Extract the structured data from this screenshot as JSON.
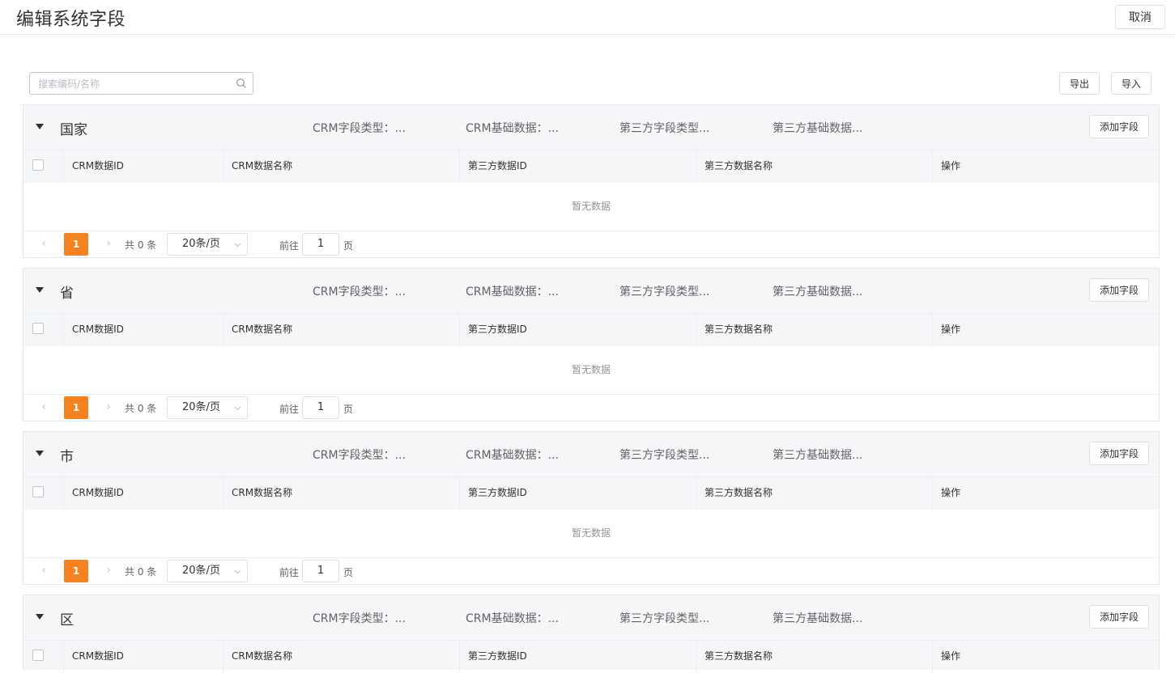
{
  "header": {
    "title": "编辑系统字段",
    "cancel_label": "取消"
  },
  "toolbar": {
    "search_placeholder": "搜索编码/名称",
    "export_label": "导出",
    "import_label": "导入"
  },
  "common": {
    "attr_crm_type": "CRM字段类型：...",
    "attr_crm_base": "CRM基础数据：...",
    "attr_third_type": "第三方字段类型...",
    "attr_third_base": "第三方基础数据...",
    "add_field_label": "添加字段",
    "columns": [
      "CRM数据ID",
      "CRM数据名称",
      "第三方数据ID",
      "第三方数据名称",
      "操作"
    ],
    "empty_text": "暂无数据",
    "pager": {
      "prev": "‹",
      "next": "›",
      "current": "1",
      "total": "共 0 条",
      "page_size": "20条/页",
      "goto_prefix": "前往",
      "goto_value": "1",
      "goto_suffix": "页"
    }
  },
  "sections": [
    {
      "title": "国家"
    },
    {
      "title": "省"
    },
    {
      "title": "市"
    },
    {
      "title": "区"
    }
  ]
}
